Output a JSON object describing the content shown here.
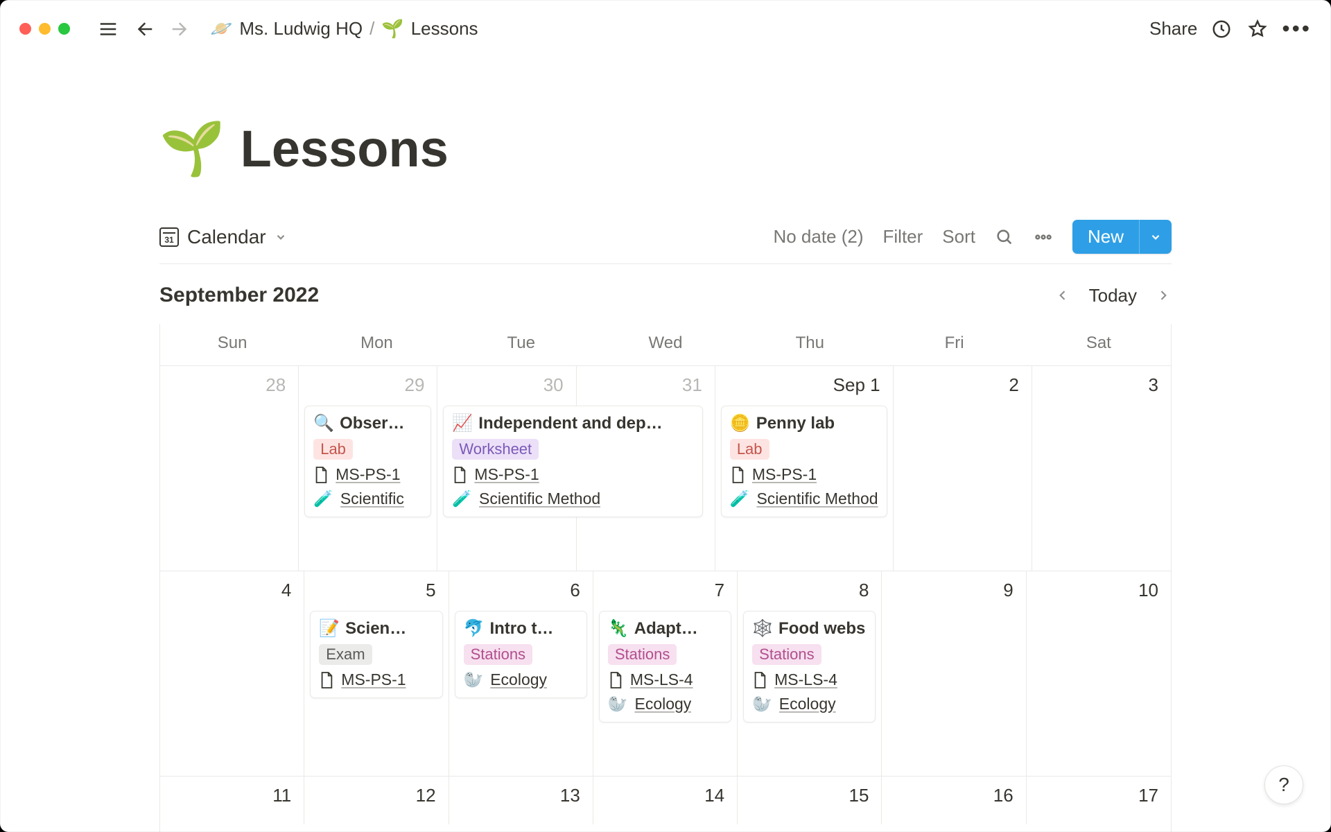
{
  "breadcrumb": {
    "parent_icon": "🪐",
    "parent_label": "Ms. Ludwig HQ",
    "sep": "/",
    "current_icon": "🌱",
    "current_label": "Lessons"
  },
  "topbar": {
    "share": "Share"
  },
  "page": {
    "icon": "🌱",
    "title": "Lessons"
  },
  "toolbar": {
    "view_icon_num": "31",
    "view_label": "Calendar",
    "no_date": "No date (2)",
    "filter": "Filter",
    "sort": "Sort",
    "new_label": "New"
  },
  "calendar": {
    "month_label": "September 2022",
    "today": "Today",
    "dow": [
      "Sun",
      "Mon",
      "Tue",
      "Wed",
      "Thu",
      "Fri",
      "Sat"
    ],
    "weeks": [
      {
        "days": [
          {
            "num": "28",
            "muted": true
          },
          {
            "num": "29",
            "muted": true,
            "card": {
              "icon": "🔍",
              "title": "Obser…",
              "tag": "Lab",
              "tag_class": "tag-lab",
              "props": [
                {
                  "type": "page",
                  "text": "MS-PS-1"
                },
                {
                  "type": "emoji",
                  "icon": "🧪",
                  "text": "Scientific"
                }
              ]
            }
          },
          {
            "num": "30",
            "muted": true,
            "wide_card": {
              "icon": "📈",
              "title": "Independent and dep…",
              "tag": "Worksheet",
              "tag_class": "tag-worksheet",
              "props": [
                {
                  "type": "page",
                  "text": "MS-PS-1"
                },
                {
                  "type": "emoji",
                  "icon": "🧪",
                  "text": "Scientific Method"
                }
              ]
            }
          },
          {
            "num": "31",
            "muted": true
          },
          {
            "num": "Sep 1",
            "card": {
              "icon": "🪙",
              "title": "Penny lab",
              "tag": "Lab",
              "tag_class": "tag-lab",
              "props": [
                {
                  "type": "page",
                  "text": "MS-PS-1"
                },
                {
                  "type": "emoji",
                  "icon": "🧪",
                  "text": "Scientific Method"
                }
              ]
            }
          },
          {
            "num": "2"
          },
          {
            "num": "3"
          }
        ]
      },
      {
        "days": [
          {
            "num": "4"
          },
          {
            "num": "5",
            "card": {
              "icon": "📝",
              "title": "Scien…",
              "tag": "Exam",
              "tag_class": "tag-exam",
              "props": [
                {
                  "type": "page",
                  "text": "MS-PS-1"
                }
              ]
            }
          },
          {
            "num": "6",
            "card": {
              "icon": "🐬",
              "title": "Intro t…",
              "tag": "Stations",
              "tag_class": "tag-stations",
              "props": [
                {
                  "type": "emoji",
                  "icon": "🦭",
                  "text": "Ecology"
                }
              ]
            }
          },
          {
            "num": "7",
            "card": {
              "icon": "🦎",
              "title": "Adapt…",
              "tag": "Stations",
              "tag_class": "tag-stations",
              "props": [
                {
                  "type": "page",
                  "text": "MS-LS-4"
                },
                {
                  "type": "emoji",
                  "icon": "🦭",
                  "text": "Ecology"
                }
              ]
            }
          },
          {
            "num": "8",
            "card": {
              "icon": "🕸️",
              "title": "Food webs",
              "tag": "Stations",
              "tag_class": "tag-stations",
              "props": [
                {
                  "type": "page",
                  "text": "MS-LS-4"
                },
                {
                  "type": "emoji",
                  "icon": "🦭",
                  "text": "Ecology"
                }
              ]
            }
          },
          {
            "num": "9"
          },
          {
            "num": "10"
          }
        ]
      },
      {
        "days": [
          {
            "num": "11"
          },
          {
            "num": "12"
          },
          {
            "num": "13"
          },
          {
            "num": "14"
          },
          {
            "num": "15"
          },
          {
            "num": "16"
          },
          {
            "num": "17"
          }
        ]
      }
    ]
  },
  "help": "?"
}
